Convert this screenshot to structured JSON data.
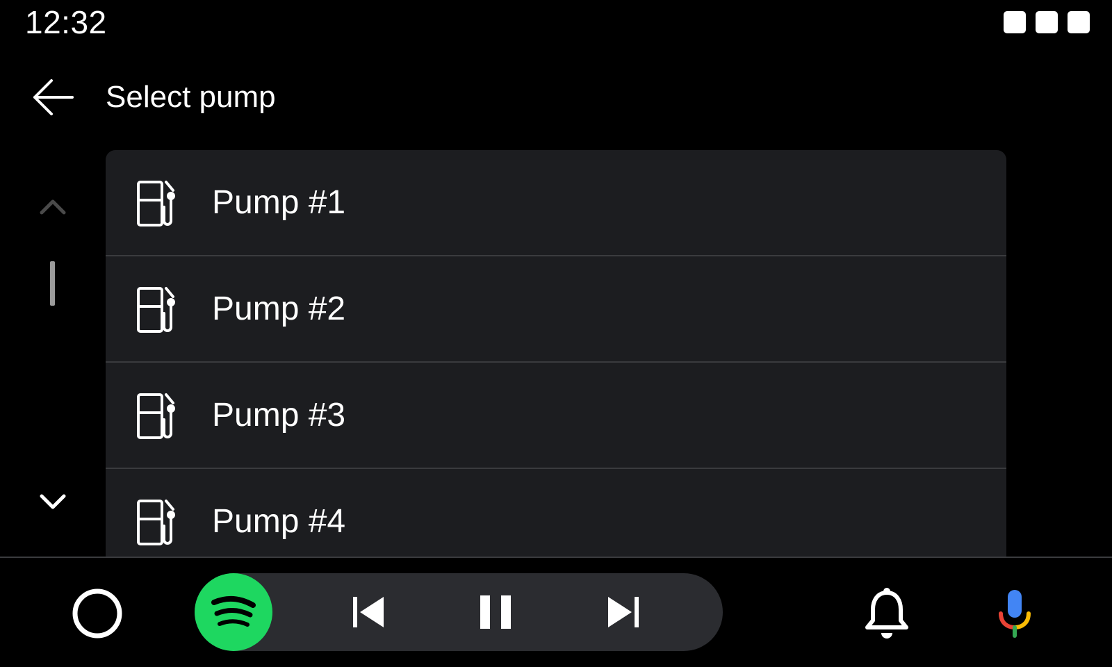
{
  "status_bar": {
    "time": "12:32",
    "icons": [
      "status-indicator-icon",
      "status-indicator-icon",
      "status-indicator-icon"
    ]
  },
  "header": {
    "back_icon": "arrow-back-icon",
    "title": "Select pump"
  },
  "scroll": {
    "up_icon": "chevron-up-icon",
    "down_icon": "chevron-down-icon"
  },
  "list": {
    "items": [
      {
        "label": "Pump #1",
        "icon": "gas-pump-icon"
      },
      {
        "label": "Pump #2",
        "icon": "gas-pump-icon"
      },
      {
        "label": "Pump #3",
        "icon": "gas-pump-icon"
      },
      {
        "label": "Pump #4",
        "icon": "gas-pump-icon"
      }
    ]
  },
  "bottom_nav": {
    "home_icon": "home-circle-icon",
    "media": {
      "app_icon": "spotify-icon",
      "app_color": "#1ED760",
      "controls": [
        "skip-previous-icon",
        "pause-icon",
        "skip-next-icon"
      ],
      "state": "playing"
    },
    "notifications_icon": "bell-icon",
    "assistant_icon": "microphone-icon"
  },
  "colors": {
    "background": "#000000",
    "list_background": "#1C1D20",
    "divider": "#3A3B3E",
    "media_pill": "#2B2C30",
    "scroll_thumb": "#9A9A9A",
    "text": "#FFFFFF"
  }
}
